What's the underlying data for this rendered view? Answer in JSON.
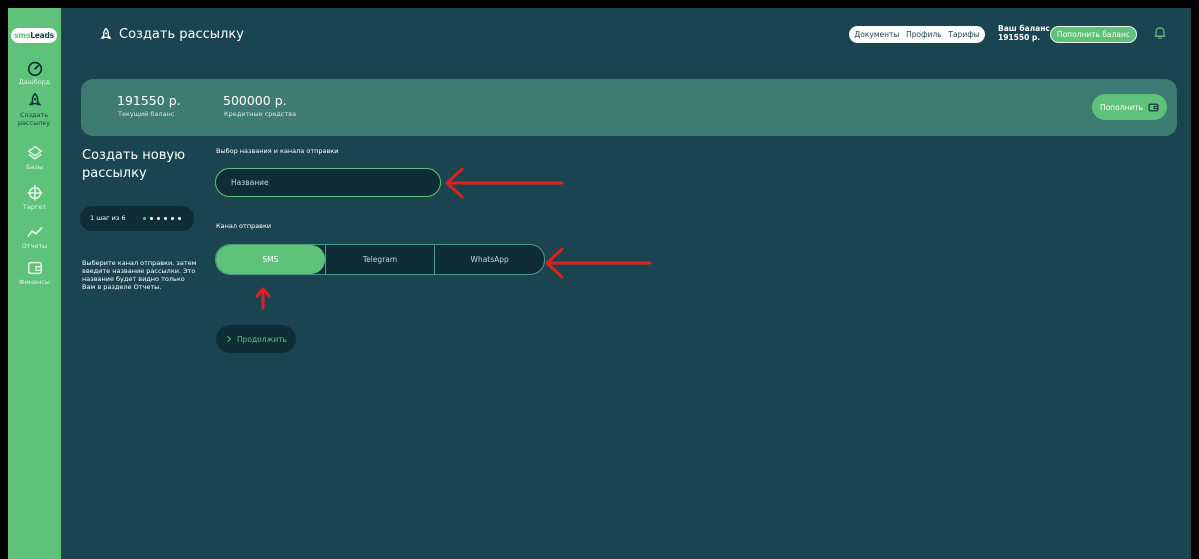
{
  "app": {
    "logo_prefix": "sms",
    "logo_suffix": "Leads"
  },
  "sidebar": {
    "items": [
      {
        "label": "Дашборд",
        "icon": "speedometer-icon",
        "active": false
      },
      {
        "label": "Создать рассылку",
        "icon": "rocket-icon",
        "active": true
      },
      {
        "label": "Базы",
        "icon": "layers-icon",
        "active": false
      },
      {
        "label": "Таргет",
        "icon": "target-icon",
        "active": false
      },
      {
        "label": "Отчеты",
        "icon": "chart-line-icon",
        "active": false
      },
      {
        "label": "Финансы",
        "icon": "wallet-icon",
        "active": false
      }
    ]
  },
  "header": {
    "title": "Создать рассылку",
    "title_icon": "rocket-icon",
    "links": [
      "Документы",
      "Профиль",
      "Тарифы"
    ],
    "balance_label": "Ваш баланс",
    "balance_value": "191550 р.",
    "topup_label": "Пополнить баланс",
    "bell_icon": "bell-icon"
  },
  "banner": {
    "balance_value": "191550 р.",
    "balance_label": "Текущий баланс",
    "credit_value": "500000 р.",
    "credit_label": "Кредитные средства",
    "topup_label": "Пополнить",
    "topup_icon": "wallet-icon"
  },
  "wizard": {
    "title": "Создать новую рассылку",
    "step_text": "1 шаг из 6",
    "steps_total": 6,
    "step_current": 1,
    "description": "Выберите канал отправки, затем введите название рассылки. Это название будет видно только Вам в разделе Отчеты."
  },
  "form": {
    "section1_label": "Выбор названия и канала отправки",
    "name_placeholder": "Название",
    "name_value": "",
    "section2_label": "Канал отправки",
    "channels": [
      {
        "label": "SMS",
        "active": true
      },
      {
        "label": "Telegram",
        "active": false
      },
      {
        "label": "WhatsApp",
        "active": false
      }
    ],
    "continue_label": "Продолжить"
  },
  "colors": {
    "background": "#1a4450",
    "sidebar": "#5ec27a",
    "accent": "#5ec27a",
    "banner": "#3e7b72",
    "dark_field": "#0f2d36",
    "annotation": "#e02020"
  }
}
